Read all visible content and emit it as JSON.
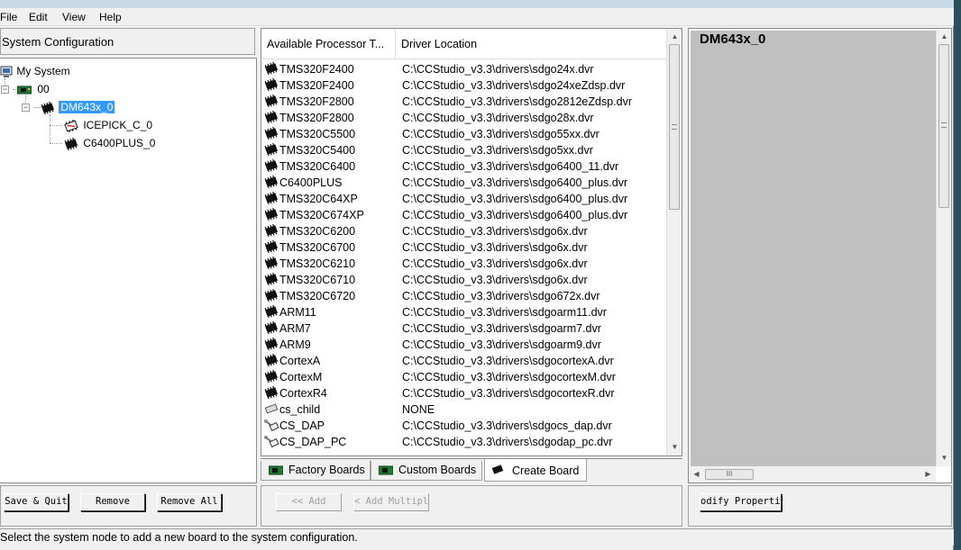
{
  "menu": {
    "file": "File",
    "edit": "Edit",
    "view": "View",
    "help": "Help"
  },
  "left_pane": {
    "header": "System Configuration",
    "tree": {
      "root": "My System",
      "board": "00",
      "processor": "DM643x_0",
      "children": [
        "ICEPICK_C_0",
        "C6400PLUS_0"
      ]
    }
  },
  "list": {
    "columns": [
      "Available Processor T...",
      "Driver Location"
    ],
    "rows": [
      {
        "name": "TMS320F2400",
        "driver": "C:\\CCStudio_v3.3\\drivers\\sdgo24x.dvr",
        "icon": "chip-icon"
      },
      {
        "name": "TMS320F2400",
        "driver": "C:\\CCStudio_v3.3\\drivers\\sdgo24xeZdsp.dvr",
        "icon": "chip-icon"
      },
      {
        "name": "TMS320F2800",
        "driver": "C:\\CCStudio_v3.3\\drivers\\sdgo2812eZdsp.dvr",
        "icon": "chip-icon"
      },
      {
        "name": "TMS320F2800",
        "driver": "C:\\CCStudio_v3.3\\drivers\\sdgo28x.dvr",
        "icon": "chip-icon"
      },
      {
        "name": "TMS320C5500",
        "driver": "C:\\CCStudio_v3.3\\drivers\\sdgo55xx.dvr",
        "icon": "chip-icon"
      },
      {
        "name": "TMS320C5400",
        "driver": "C:\\CCStudio_v3.3\\drivers\\sdgo5xx.dvr",
        "icon": "chip-icon"
      },
      {
        "name": "TMS320C6400",
        "driver": "C:\\CCStudio_v3.3\\drivers\\sdgo6400_11.dvr",
        "icon": "chip-icon"
      },
      {
        "name": "C6400PLUS",
        "driver": "C:\\CCStudio_v3.3\\drivers\\sdgo6400_plus.dvr",
        "icon": "chip-icon"
      },
      {
        "name": "TMS320C64XP",
        "driver": "C:\\CCStudio_v3.3\\drivers\\sdgo6400_plus.dvr",
        "icon": "chip-icon"
      },
      {
        "name": "TMS320C674XP",
        "driver": "C:\\CCStudio_v3.3\\drivers\\sdgo6400_plus.dvr",
        "icon": "chip-icon"
      },
      {
        "name": "TMS320C6200",
        "driver": "C:\\CCStudio_v3.3\\drivers\\sdgo6x.dvr",
        "icon": "chip-icon"
      },
      {
        "name": "TMS320C6700",
        "driver": "C:\\CCStudio_v3.3\\drivers\\sdgo6x.dvr",
        "icon": "chip-icon"
      },
      {
        "name": "TMS320C6210",
        "driver": "C:\\CCStudio_v3.3\\drivers\\sdgo6x.dvr",
        "icon": "chip-icon"
      },
      {
        "name": "TMS320C6710",
        "driver": "C:\\CCStudio_v3.3\\drivers\\sdgo6x.dvr",
        "icon": "chip-icon"
      },
      {
        "name": "TMS320C6720",
        "driver": "C:\\CCStudio_v3.3\\drivers\\sdgo672x.dvr",
        "icon": "chip-icon"
      },
      {
        "name": "ARM11",
        "driver": "C:\\CCStudio_v3.3\\drivers\\sdgoarm11.dvr",
        "icon": "chip-icon"
      },
      {
        "name": "ARM7",
        "driver": "C:\\CCStudio_v3.3\\drivers\\sdgoarm7.dvr",
        "icon": "chip-icon"
      },
      {
        "name": "ARM9",
        "driver": "C:\\CCStudio_v3.3\\drivers\\sdgoarm9.dvr",
        "icon": "chip-icon"
      },
      {
        "name": "CortexA",
        "driver": "C:\\CCStudio_v3.3\\drivers\\sdgocortexA.dvr",
        "icon": "chip-icon"
      },
      {
        "name": "CortexM",
        "driver": "C:\\CCStudio_v3.3\\drivers\\sdgocortexM.dvr",
        "icon": "chip-icon"
      },
      {
        "name": "CortexR4",
        "driver": "C:\\CCStudio_v3.3\\drivers\\sdgocortexR.dvr",
        "icon": "chip-icon"
      },
      {
        "name": "cs_child",
        "driver": "NONE",
        "icon": "small-chip-icon"
      },
      {
        "name": "CS_DAP",
        "driver": "C:\\CCStudio_v3.3\\drivers\\sdgocs_dap.dvr",
        "icon": "probe-icon"
      },
      {
        "name": "CS_DAP_PC",
        "driver": "C:\\CCStudio_v3.3\\drivers\\sdgodap_pc.dvr",
        "icon": "probe-icon"
      }
    ]
  },
  "tabs": [
    "Factory Boards",
    "Custom Boards",
    "Create Board"
  ],
  "active_tab": "Create Board",
  "props": {
    "title": "DM643x_0"
  },
  "buttons": {
    "save_quit": "Save & Quit",
    "remove": "Remove",
    "remove_all": "Remove All",
    "add": "<< Add",
    "add_multiple": "< Add Multipl",
    "modify_properties": "odify Propertie"
  },
  "status": "Select the system node to add a new board to the system configuration.",
  "colors": {
    "selection": "#3399ff",
    "props_bg": "#c0c0c0"
  }
}
